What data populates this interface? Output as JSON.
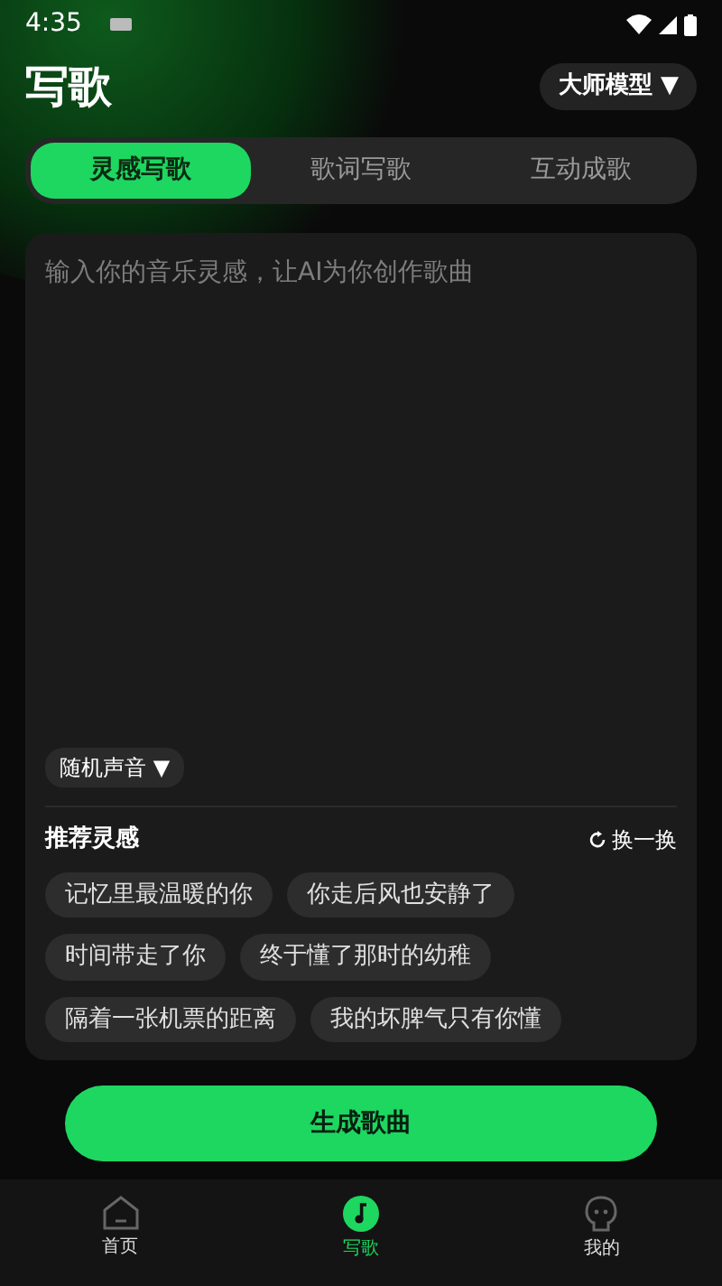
{
  "status_bar": {
    "time": "4:35"
  },
  "header": {
    "title": "写歌",
    "model_menu": "大师模型 ▼"
  },
  "tabs": [
    {
      "label": "灵感写歌",
      "selected": true
    },
    {
      "label": "歌词写歌",
      "selected": false
    },
    {
      "label": "互动成歌",
      "selected": false
    }
  ],
  "prompt": {
    "placeholder": "输入你的音乐灵感，让AI为你创作歌曲"
  },
  "voice_menu": "随机声音 ▼",
  "inspiration": {
    "title": "推荐灵感",
    "refresh": "换一换",
    "chips": [
      {
        "label": "记忆里最温暖的你"
      },
      {
        "label": "你走后风也安静了"
      },
      {
        "label": "时间带走了你"
      },
      {
        "label": "终于懂了那时的幼稚"
      },
      {
        "label": "隔着一张机票的距离"
      },
      {
        "label": "我的坏脾气只有你懂"
      }
    ]
  },
  "generate_button": "生成歌曲",
  "bottom_nav": [
    {
      "kind": "home",
      "label": "首页",
      "selected": false
    },
    {
      "kind": "music",
      "label": "写歌",
      "selected": true
    },
    {
      "kind": "profile",
      "label": "我的",
      "selected": false
    }
  ]
}
